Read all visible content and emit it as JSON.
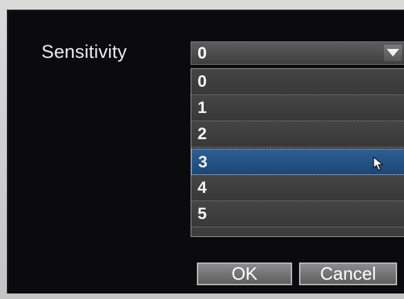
{
  "dialog": {
    "sensitivity_label": "Sensitivity",
    "select_value": "0",
    "options": [
      "0",
      "1",
      "2",
      "3",
      "4",
      "5"
    ],
    "highlighted_option": "3",
    "ok_label": "OK",
    "cancel_label": "Cancel"
  },
  "colors": {
    "background": "#0b0b0d",
    "highlight": "#1d4677",
    "option_bg": "#3e3e3e"
  },
  "icons": [
    "dropdown-arrow-icon",
    "mouse-cursor-icon"
  ]
}
